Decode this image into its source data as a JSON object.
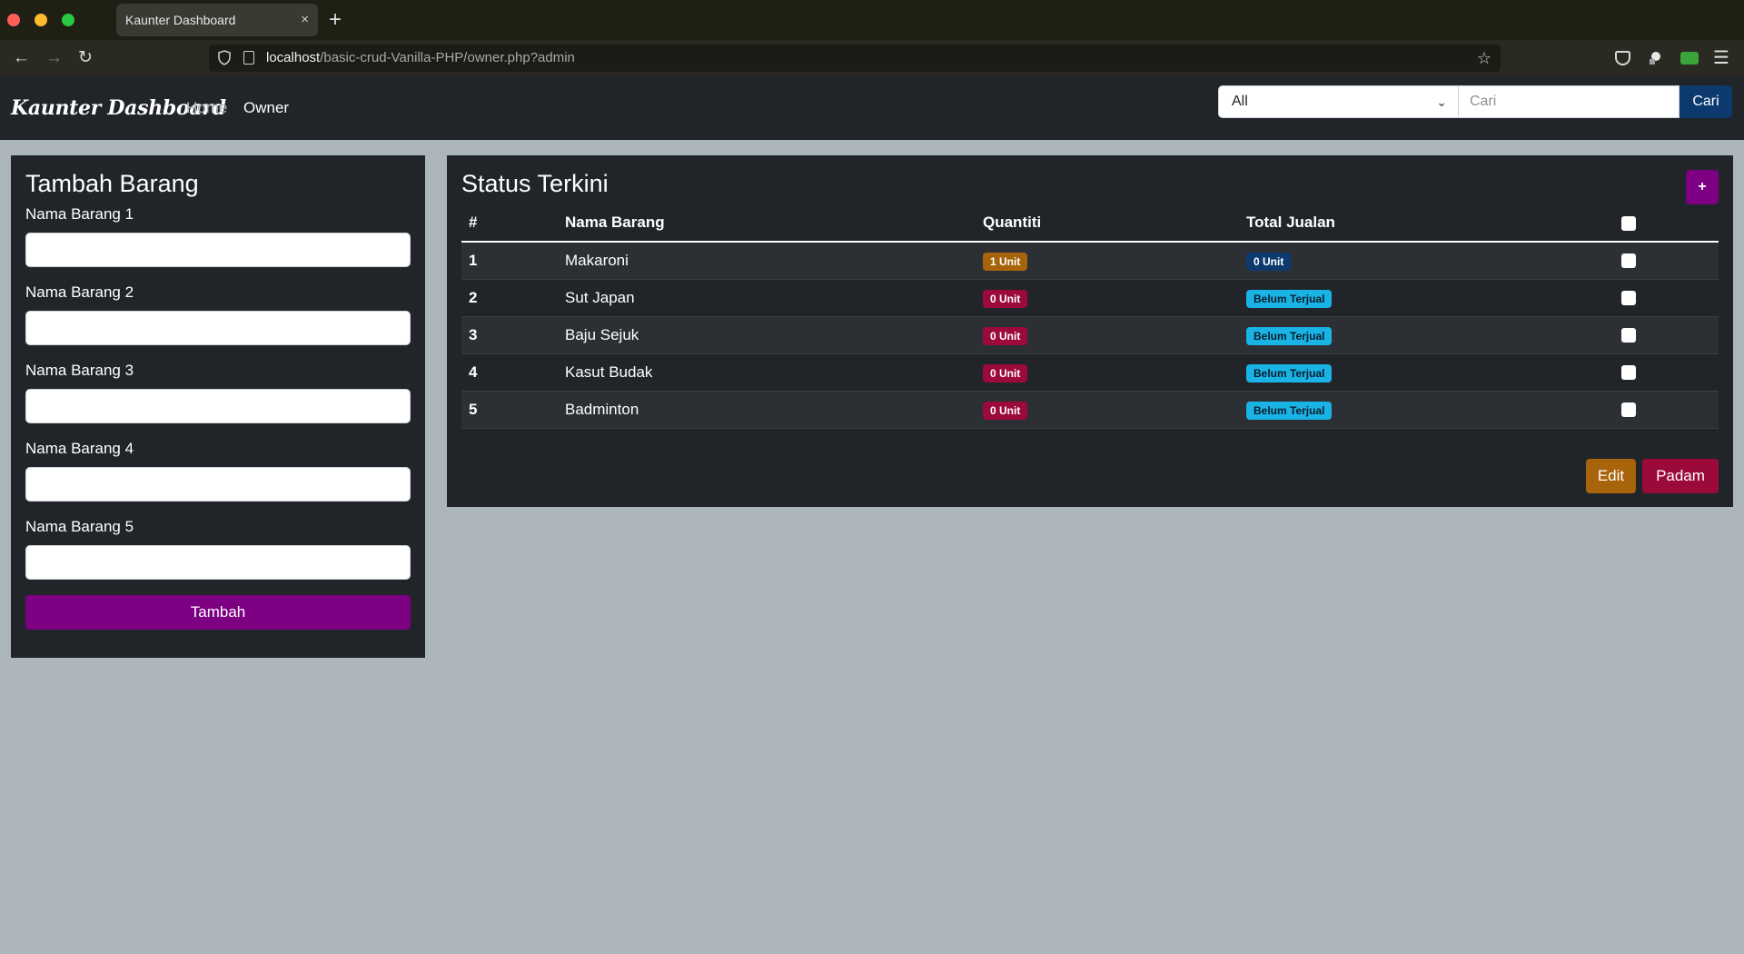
{
  "browser": {
    "tab_title": "Kaunter Dashboard",
    "tab_close": "×",
    "new_tab": "+",
    "url_host": "localhost",
    "url_path": "/basic-crud-Vanilla-PHP/owner.php?admin",
    "icons": [
      "back-icon",
      "forward-icon",
      "reload-icon",
      "shield-icon",
      "page-icon",
      "star-icon",
      "pocket-icon",
      "extension-icon",
      "menu-icon"
    ]
  },
  "nav": {
    "brand": "Kaunter Dashboard",
    "links": [
      "Home",
      "Owner"
    ],
    "filter_selected": "All",
    "search_placeholder": "Cari",
    "search_button": "Cari"
  },
  "left_card": {
    "title": "Tambah Barang",
    "fields": [
      "Nama Barang 1",
      "Nama Barang 2",
      "Nama Barang 3",
      "Nama Barang 4",
      "Nama Barang 5"
    ],
    "submit": "Tambah"
  },
  "right_card": {
    "title": "Status Terkini",
    "add_button": "+",
    "columns": [
      "#",
      "Nama Barang",
      "Quantiti",
      "Total Jualan"
    ],
    "rows": [
      {
        "num": "1",
        "name": "Makaroni",
        "qty": "1 Unit",
        "total": "0 Unit"
      },
      {
        "num": "2",
        "name": "Sut Japan",
        "qty": "0 Unit",
        "total": "Belum Terjual"
      },
      {
        "num": "3",
        "name": "Baju Sejuk",
        "qty": "0 Unit",
        "total": "Belum Terjual"
      },
      {
        "num": "4",
        "name": "Kasut Budak",
        "qty": "0 Unit",
        "total": "Belum Terjual"
      },
      {
        "num": "5",
        "name": "Badminton",
        "qty": "0 Unit",
        "total": "Belum Terjual"
      }
    ],
    "edit_button": "Edit",
    "delete_button": "Padam"
  },
  "colors": {
    "purple": "#7d0083",
    "warning": "#a8640a",
    "danger": "#9c0a3b",
    "primary": "#0d3a6e",
    "info": "#1ab3e6"
  }
}
